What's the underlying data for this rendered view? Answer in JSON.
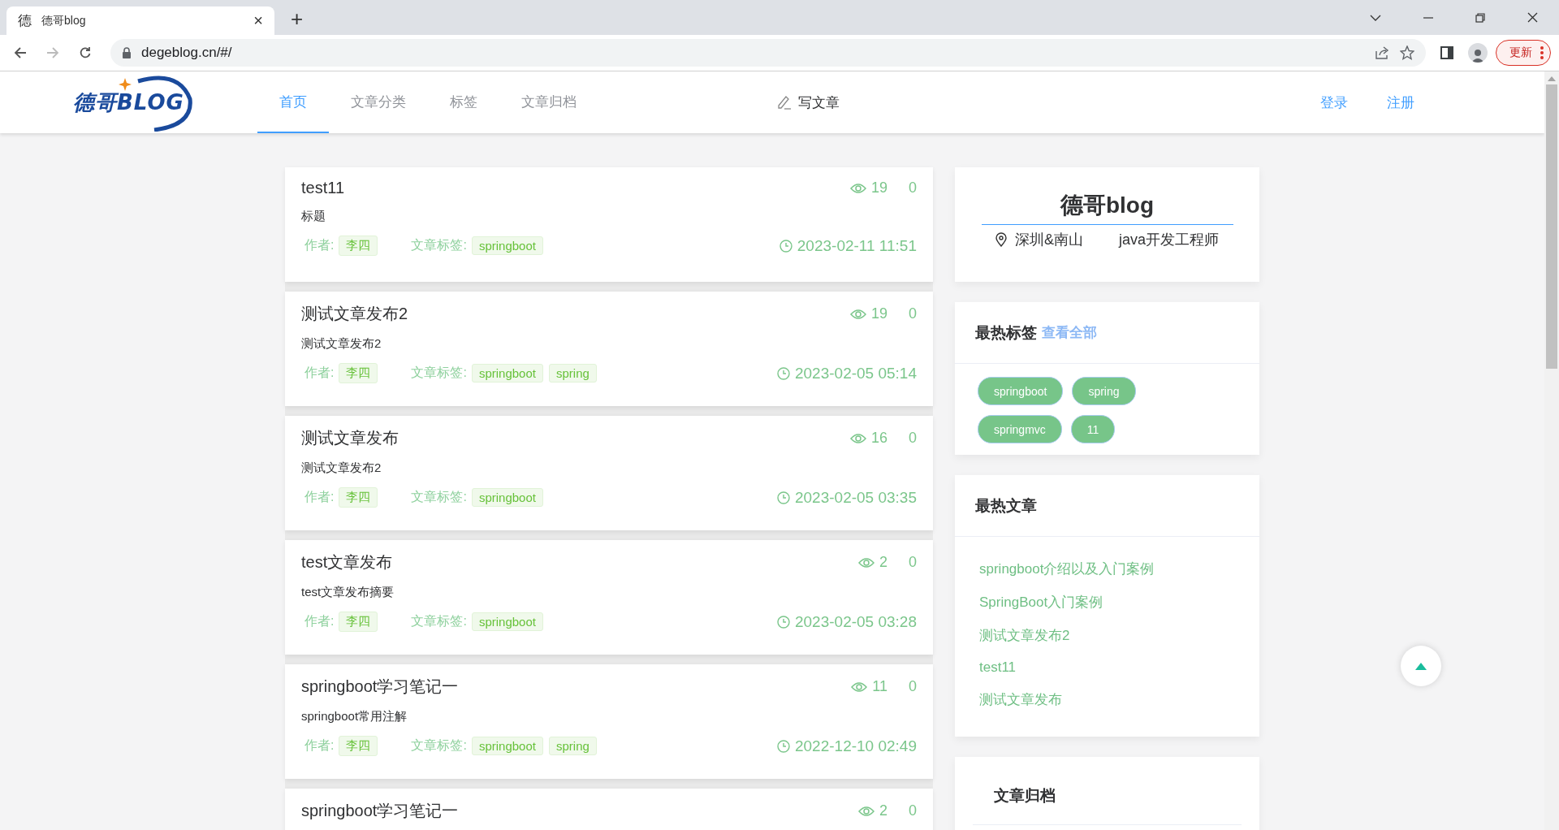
{
  "browser": {
    "tab": {
      "favicon": "德",
      "title": "德哥blog",
      "close": "×"
    },
    "new_tab": "+",
    "address": "degeblog.cn/#/",
    "update_button": "更新"
  },
  "header": {
    "logo": {
      "cn": "德哥",
      "en": "BLOG"
    },
    "nav": [
      {
        "label": "首页",
        "selected": true
      },
      {
        "label": "文章分类",
        "selected": false
      },
      {
        "label": "标签",
        "selected": false
      },
      {
        "label": "文章归档",
        "selected": false
      }
    ],
    "write": "写文章",
    "login": "登录",
    "register": "注册"
  },
  "articles": [
    {
      "title": "test11",
      "summary": "标题",
      "views": "19",
      "comments": "0",
      "author_label": "作者:",
      "author": "李四",
      "tags_label": "文章标签:",
      "tags": [
        "springboot"
      ],
      "date": "2023-02-11 11:51"
    },
    {
      "title": "测试文章发布2",
      "summary": "测试文章发布2",
      "views": "19",
      "comments": "0",
      "author_label": "作者:",
      "author": "李四",
      "tags_label": "文章标签:",
      "tags": [
        "springboot",
        "spring"
      ],
      "date": "2023-02-05 05:14"
    },
    {
      "title": "测试文章发布",
      "summary": "测试文章发布2",
      "views": "16",
      "comments": "0",
      "author_label": "作者:",
      "author": "李四",
      "tags_label": "文章标签:",
      "tags": [
        "springboot"
      ],
      "date": "2023-02-05 03:35"
    },
    {
      "title": "test文章发布",
      "summary": "test文章发布摘要",
      "views": "2",
      "comments": "0",
      "author_label": "作者:",
      "author": "李四",
      "tags_label": "文章标签:",
      "tags": [
        "springboot"
      ],
      "date": "2023-02-05 03:28"
    },
    {
      "title": "springboot学习笔记一",
      "summary": "springboot常用注解",
      "views": "11",
      "comments": "0",
      "author_label": "作者:",
      "author": "李四",
      "tags_label": "文章标签:",
      "tags": [
        "springboot",
        "spring"
      ],
      "date": "2022-12-10 02:49"
    },
    {
      "title": "springboot学习笔记一",
      "views": "2",
      "comments": "0"
    }
  ],
  "profile": {
    "name": "德哥blog",
    "location": "深圳&南山",
    "job": "java开发工程师"
  },
  "hot_tags": {
    "title": "最热标签",
    "more": "查看全部",
    "tags": [
      "springboot",
      "spring",
      "springmvc",
      "11"
    ]
  },
  "hot_articles": {
    "title": "最热文章",
    "items": [
      "springboot介绍以及入门案例",
      "SpringBoot入门案例",
      "测试文章发布2",
      "test11",
      "测试文章发布"
    ]
  },
  "archive": {
    "title": "文章归档"
  }
}
